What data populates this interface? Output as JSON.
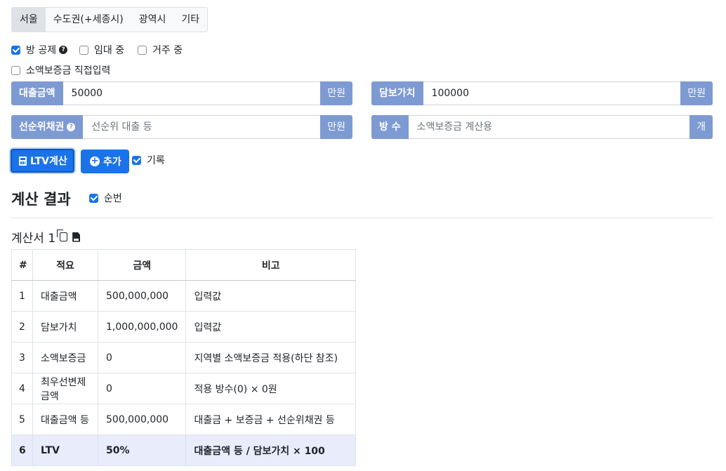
{
  "tabs": [
    "서울",
    "수도권(+세종시)",
    "광역시",
    "기타"
  ],
  "options": {
    "room_deduction": "방 공제",
    "renting": "임대 중",
    "living": "거주 중",
    "direct_input": "소액보증금 직접입력"
  },
  "inputs": {
    "loan": {
      "label": "대출금액",
      "value": "50000",
      "unit": "만원"
    },
    "collateral": {
      "label": "담보가치",
      "value": "100000",
      "unit": "만원"
    },
    "senior": {
      "label": "선순위채권",
      "placeholder": "선순위 대출 등",
      "unit": "만원"
    },
    "rooms": {
      "label": "방 수",
      "placeholder": "소액보증금 계산용",
      "unit": "개"
    }
  },
  "buttons": {
    "ltv": "LTV계산",
    "add": "추가",
    "record": "기록"
  },
  "result": {
    "title": "계산 결과",
    "order_label": "순번",
    "sheet_title": "계산서 1"
  },
  "table": {
    "headers": [
      "#",
      "적요",
      "금액",
      "비고"
    ],
    "rows": [
      [
        "1",
        "대출금액",
        "500,000,000",
        "입력값"
      ],
      [
        "2",
        "담보가치",
        "1,000,000,000",
        "입력값"
      ],
      [
        "3",
        "소액보증금",
        "0",
        "지역별 소액보증금 적용(하단 참조)"
      ],
      [
        "4",
        "최우선변제금액",
        "0",
        "적용 방수(0) × 0원"
      ],
      [
        "5",
        "대출금액 등",
        "500,000,000",
        "대출금 + 보증금 + 선순위채권 등"
      ],
      [
        "6",
        "LTV",
        "50%",
        "대출금액 등 / 담보가치 × 100"
      ]
    ]
  },
  "colors": {
    "accent": "#7d9ad3",
    "primary": "#1a73e8",
    "total_row": "#e8ecfb"
  },
  "icons": [
    "question-icon",
    "calculator-icon",
    "plus-circle-icon",
    "copy-icon",
    "csv-file-icon"
  ]
}
